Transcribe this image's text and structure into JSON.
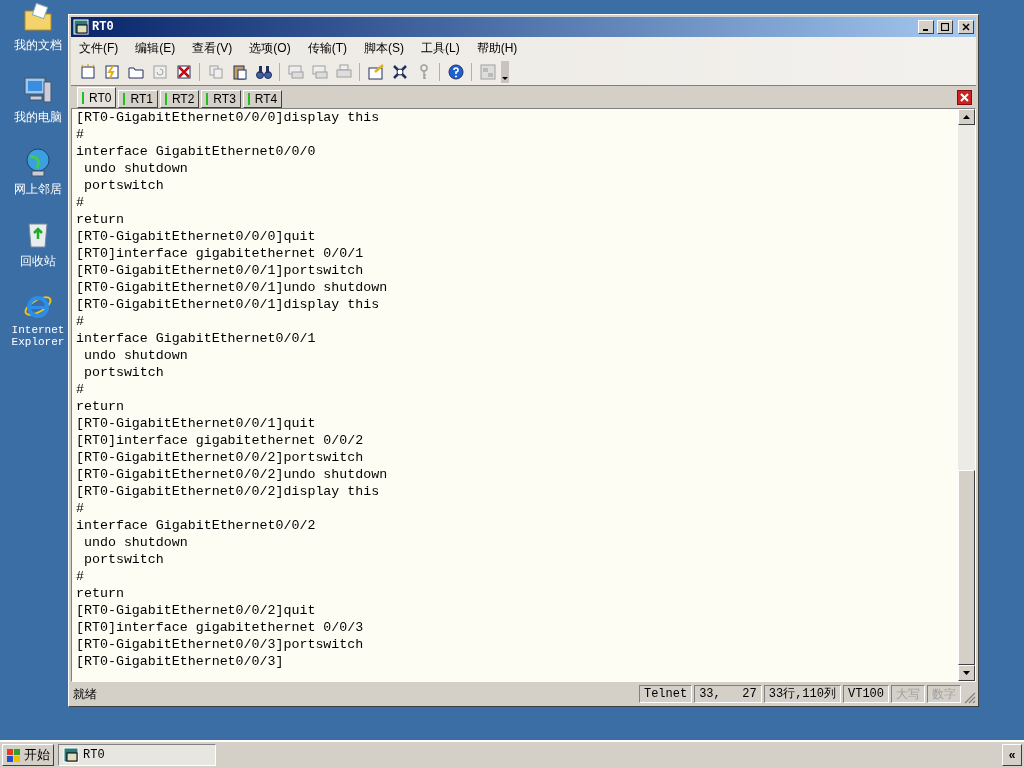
{
  "desktop_icons": [
    {
      "kind": "documents",
      "label": "我的文档"
    },
    {
      "kind": "computer",
      "label": "我的电脑"
    },
    {
      "kind": "network",
      "label": "网上邻居"
    },
    {
      "kind": "recycle",
      "label": "回收站"
    },
    {
      "kind": "browser",
      "label": "Internet Explorer"
    }
  ],
  "window": {
    "title": "RT0"
  },
  "menu": [
    "文件(F)",
    "编辑(E)",
    "查看(V)",
    "选项(O)",
    "传输(T)",
    "脚本(S)",
    "工具(L)",
    "帮助(H)"
  ],
  "toolbar": [
    {
      "kind": "new",
      "disabled": false
    },
    {
      "kind": "connect",
      "disabled": false
    },
    {
      "kind": "folder",
      "disabled": false
    },
    {
      "kind": "reconnect",
      "disabled": true
    },
    {
      "kind": "disconnect",
      "disabled": false
    },
    {
      "kind": "sep"
    },
    {
      "kind": "copy",
      "disabled": true
    },
    {
      "kind": "paste",
      "disabled": false
    },
    {
      "kind": "find",
      "disabled": false
    },
    {
      "kind": "sep"
    },
    {
      "kind": "print-setup",
      "disabled": true
    },
    {
      "kind": "print-selection",
      "disabled": true
    },
    {
      "kind": "print",
      "disabled": true
    },
    {
      "kind": "sep"
    },
    {
      "kind": "session-options",
      "disabled": false
    },
    {
      "kind": "global-options",
      "disabled": false
    },
    {
      "kind": "key",
      "disabled": true
    },
    {
      "kind": "sep"
    },
    {
      "kind": "help",
      "disabled": false
    },
    {
      "kind": "sep"
    },
    {
      "kind": "sftp",
      "disabled": true
    }
  ],
  "tabs": [
    {
      "label": "RT0",
      "selected": true
    },
    {
      "label": "RT1",
      "selected": false
    },
    {
      "label": "RT2",
      "selected": false
    },
    {
      "label": "RT3",
      "selected": false
    },
    {
      "label": "RT4",
      "selected": false
    }
  ],
  "terminal_lines": [
    "[RT0-GigabitEthernet0/0/0]display this",
    "#",
    "interface GigabitEthernet0/0/0",
    " undo shutdown",
    " portswitch",
    "#",
    "return",
    "[RT0-GigabitEthernet0/0/0]quit",
    "[RT0]interface gigabitethernet 0/0/1",
    "[RT0-GigabitEthernet0/0/1]portswitch",
    "[RT0-GigabitEthernet0/0/1]undo shutdown",
    "[RT0-GigabitEthernet0/0/1]display this",
    "#",
    "interface GigabitEthernet0/0/1",
    " undo shutdown",
    " portswitch",
    "#",
    "return",
    "[RT0-GigabitEthernet0/0/1]quit",
    "[RT0]interface gigabitethernet 0/0/2",
    "[RT0-GigabitEthernet0/0/2]portswitch",
    "[RT0-GigabitEthernet0/0/2]undo shutdown",
    "[RT0-GigabitEthernet0/0/2]display this",
    "#",
    "interface GigabitEthernet0/0/2",
    " undo shutdown",
    " portswitch",
    "#",
    "return",
    "[RT0-GigabitEthernet0/0/2]quit",
    "[RT0]interface gigabitethernet 0/0/3",
    "[RT0-GigabitEthernet0/0/3]portswitch",
    "[RT0-GigabitEthernet0/0/3]"
  ],
  "status_bar": {
    "message": "就绪",
    "panels": [
      {
        "text": "Telnet",
        "disabled": false
      },
      {
        "text": "33,   27",
        "disabled": false
      },
      {
        "text": "33行,110列",
        "disabled": false
      },
      {
        "text": "VT100",
        "disabled": false
      },
      {
        "text": "大写",
        "disabled": true
      },
      {
        "text": "数字",
        "disabled": true
      }
    ]
  },
  "taskbar": {
    "start": "开始",
    "tasks": [
      {
        "label": "RT0",
        "selected": true
      }
    ],
    "tray_button": "«"
  }
}
